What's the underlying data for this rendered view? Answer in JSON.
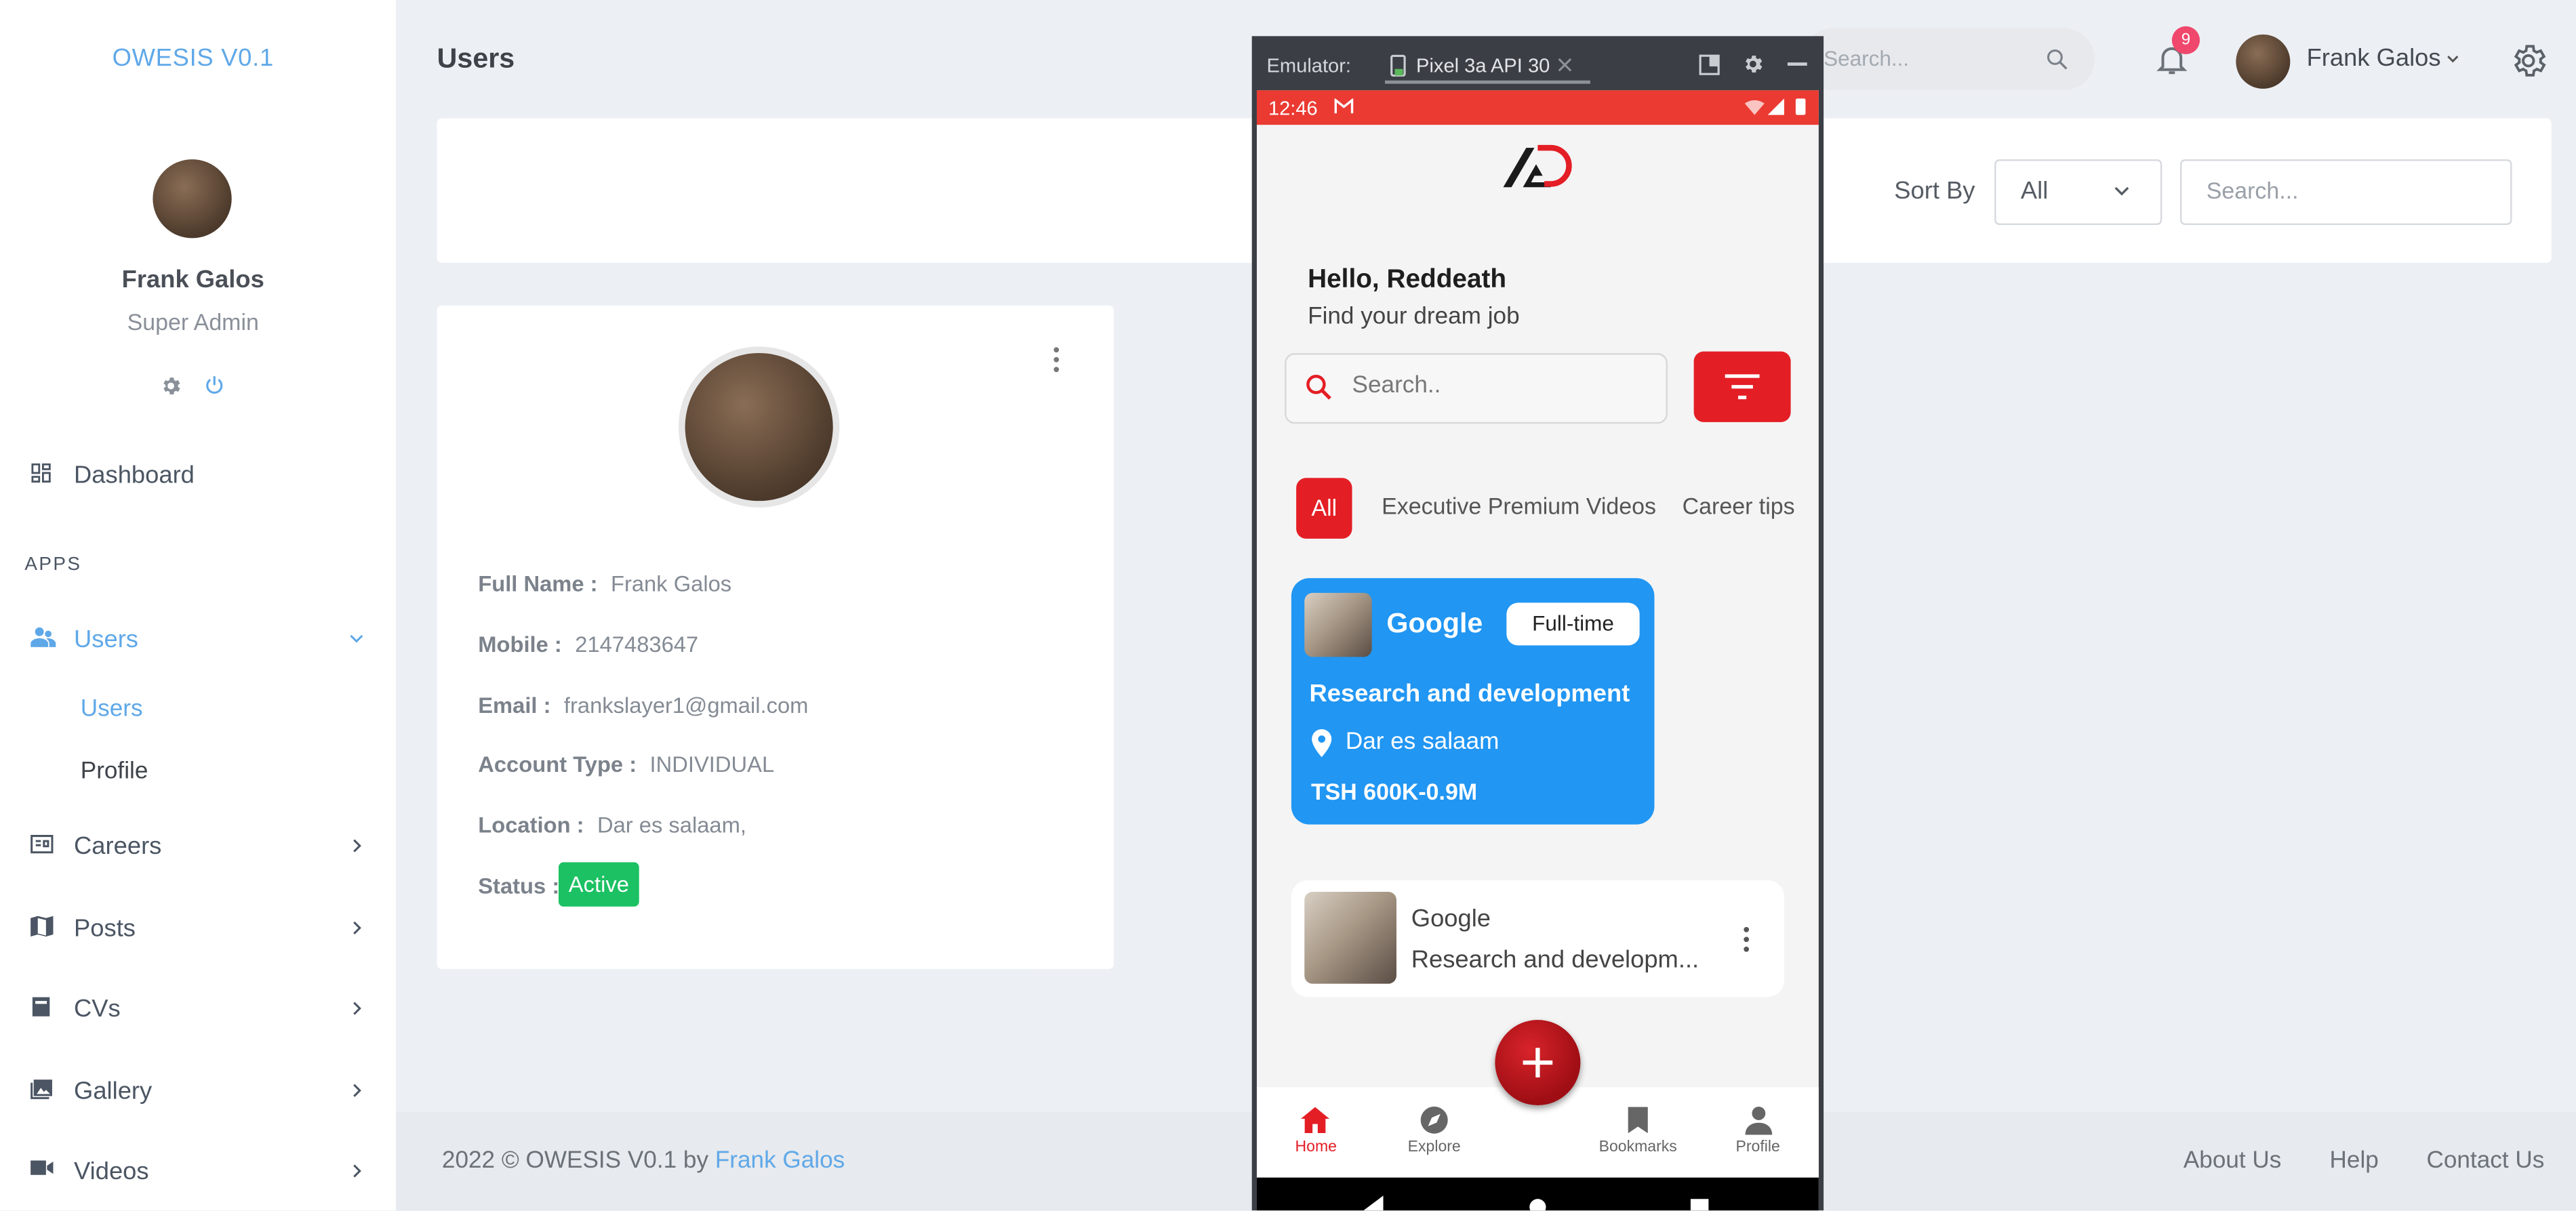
{
  "sidebar": {
    "brand": "OWESIS V0.1",
    "user_name": "Frank Galos",
    "user_role": "Super Admin",
    "dashboard_label": "Dashboard",
    "apps_label": "APPS",
    "users_label": "Users",
    "sub_users_label": "Users",
    "sub_profile_label": "Profile",
    "careers_label": "Careers",
    "posts_label": "Posts",
    "cvs_label": "CVs",
    "gallery_label": "Gallery",
    "videos_label": "Videos"
  },
  "header": {
    "page_title": "Users",
    "search_placeholder": "Search...",
    "notification_count": "9",
    "user_name": "Frank Galos"
  },
  "filter": {
    "sort_label": "Sort By",
    "sort_value": "All",
    "search_placeholder": "Search..."
  },
  "profile": {
    "full_name_label": "Full Name :",
    "full_name": "Frank Galos",
    "mobile_label": "Mobile :",
    "mobile": "2147483647",
    "email_label": "Email :",
    "email": "frankslayer1@gmail.com",
    "account_type_label": "Account Type :",
    "account_type": "INDIVIDUAL",
    "location_label": "Location :",
    "location": "Dar es salaam,",
    "status_label": "Status :",
    "status": "Active"
  },
  "footer": {
    "copyright": "2022 © OWESIS V0.1 by",
    "author": "Frank Galos",
    "about": "About Us",
    "help": "Help",
    "contact": "Contact Us"
  },
  "emulator": {
    "title": "Emulator:",
    "device_tab": "Pixel 3a API 30",
    "phone": {
      "time": "12:46",
      "greeting": "Hello, Reddeath",
      "subtitle": "Find your dream job",
      "search_placeholder": "Search..",
      "chips": [
        "All",
        "Executive Premium Videos",
        "Career tips"
      ],
      "featured_job": {
        "company": "Google",
        "type": "Full-time",
        "title": "Research and development",
        "location": "Dar es salaam",
        "salary": "TSH 600K-0.9M"
      },
      "list_job": {
        "company": "Google",
        "title": "Research and developm..."
      },
      "nav": [
        "Home",
        "Explore",
        "Bookmarks",
        "Profile"
      ]
    }
  },
  "colors": {
    "accent": "#5fa8e8",
    "brand_red": "#e41e25",
    "job_card_blue": "#2196f3",
    "status_green": "#1bc162",
    "badge_red": "#f0476c"
  }
}
